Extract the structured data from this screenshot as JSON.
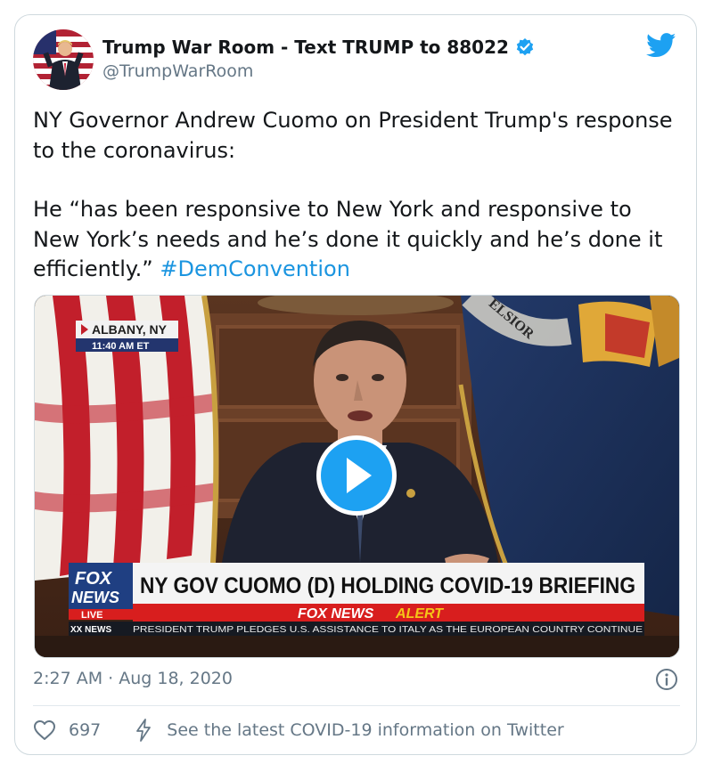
{
  "tweet": {
    "display_name": "Trump War Room - Text TRUMP to 88022",
    "handle": "@TrumpWarRoom",
    "text_line1": "NY Governor Andrew Cuomo on President Trump's response to the coronavirus:",
    "text_line2": "He “has been responsive to New York and responsive to New York’s needs and he’s done it quickly and he’s done it efficiently.” ",
    "hashtag": "#DemConvention",
    "timestamp": "2:27 AM · Aug 18, 2020",
    "like_count": "697",
    "covid_link": "See the latest COVID-19 information on Twitter"
  },
  "video": {
    "location_label": "ALBANY, NY",
    "time_label": "11:40 AM ET",
    "network_logo_top": "FOX",
    "network_logo_bottom": "NEWS",
    "live_label": "LIVE",
    "chyron_headline": "NY GOV CUOMO (D) HOLDING COVID-19 BRIEFING",
    "alert_prefix": "FOX NEWS",
    "alert_word": "ALERT",
    "ticker_source": "XX NEWS",
    "ticker_text": "PRESIDENT TRUMP PLEDGES U.S. ASSISTANCE TO ITALY AS THE EUROPEAN COUNTRY CONTINUE",
    "flag_text": "ELSIOR"
  },
  "colors": {
    "link": "#1b95e0",
    "secondary_text": "#657786",
    "twitter_blue": "#1da1f2",
    "alert_red": "#d81e1e",
    "chyron_white": "#f4f4f4"
  },
  "icons": {
    "verified": "verified-badge-icon",
    "bird": "twitter-bird-icon",
    "play": "play-icon",
    "info": "info-icon",
    "heart": "heart-icon",
    "bolt": "lightning-bolt-icon"
  }
}
